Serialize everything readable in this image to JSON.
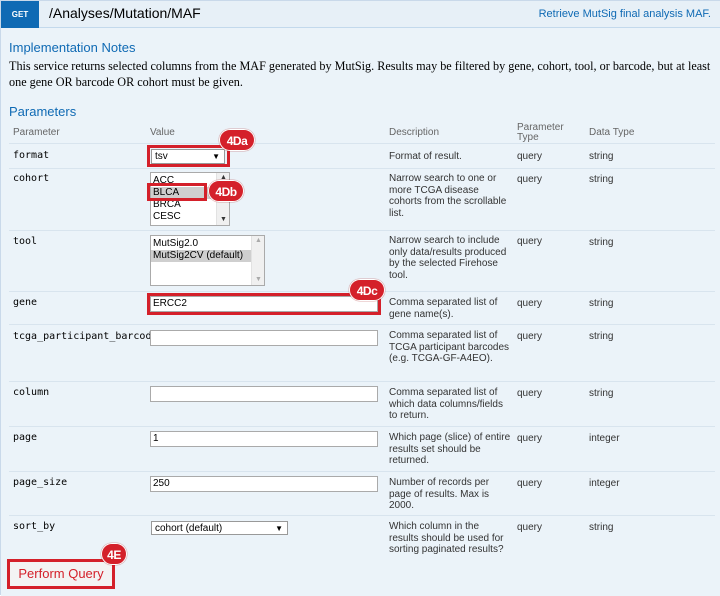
{
  "header": {
    "method": "GET",
    "path": "/Analyses/Mutation/MAF",
    "summary": "Retrieve MutSig final analysis MAF."
  },
  "implementation": {
    "title": "Implementation Notes",
    "text": "This service returns selected columns from the MAF generated by MutSig. Results may be filtered by gene, cohort, tool, or barcode, but at least one gene OR barcode OR cohort must be given."
  },
  "parameters_title": "Parameters",
  "columns": {
    "parameter": "Parameter",
    "value": "Value",
    "description": "Description",
    "param_type_1": "Parameter",
    "param_type_2": "Type",
    "data_type": "Data Type"
  },
  "params": {
    "format": {
      "name": "format",
      "value": "tsv",
      "description": "Format of result.",
      "type": "query",
      "data_type": "string"
    },
    "cohort": {
      "name": "cohort",
      "options": [
        "ACC",
        "BLCA",
        "BRCA",
        "CESC"
      ],
      "description": "Narrow search to one or more TCGA disease cohorts from the scrollable list.",
      "type": "query",
      "data_type": "string"
    },
    "tool": {
      "name": "tool",
      "options": [
        "MutSig2.0",
        "MutSig2CV (default)"
      ],
      "description": "Narrow search to include only data/results produced by the selected Firehose tool.",
      "type": "query",
      "data_type": "string"
    },
    "gene": {
      "name": "gene",
      "value": "ERCC2",
      "description": "Comma separated list of gene name(s).",
      "type": "query",
      "data_type": "string"
    },
    "barcode": {
      "name": "tcga_participant_barcode",
      "value": "",
      "description": "Comma separated list of TCGA participant barcodes (e.g. TCGA-GF-A4EO).",
      "type": "query",
      "data_type": "string"
    },
    "column": {
      "name": "column",
      "value": "",
      "description": "Comma separated list of which data columns/fields to return.",
      "type": "query",
      "data_type": "string"
    },
    "page": {
      "name": "page",
      "value": "1",
      "description": "Which page (slice) of entire results set should be returned.",
      "type": "query",
      "data_type": "integer"
    },
    "page_size": {
      "name": "page_size",
      "value": "250",
      "description": "Number of records per page of results. Max is 2000.",
      "type": "query",
      "data_type": "integer"
    },
    "sort_by": {
      "name": "sort_by",
      "value": "cohort (default)",
      "description": "Which column in the results should be used for sorting paginated results?",
      "type": "query",
      "data_type": "string"
    }
  },
  "annotations": {
    "format": "4Da",
    "cohort": "4Db",
    "gene": "4Dc",
    "submit": "4E"
  },
  "submit_label": "Perform Query",
  "colors": {
    "accent": "#0f6ab4",
    "highlight": "#d4202a",
    "panel": "#ebf3f9"
  }
}
